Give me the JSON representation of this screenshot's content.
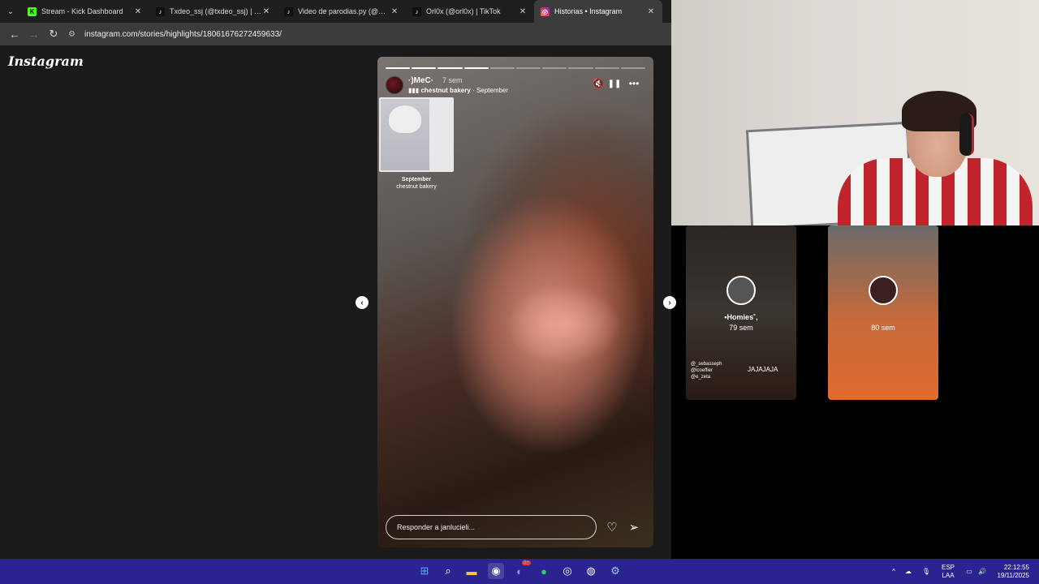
{
  "browser": {
    "tabs": [
      {
        "title": "Stream - Kick Dashboard",
        "favicon": "kick-icon",
        "color": "#53fc18"
      },
      {
        "title": "Txdeo_ssj (@txdeo_ssj) | TikTok",
        "favicon": "tiktok-icon",
        "color": "#111111"
      },
      {
        "title": "Video de parodias.py (@parodi",
        "favicon": "tiktok-icon",
        "color": "#111111"
      },
      {
        "title": "Orl0x (@orl0x) | TikTok",
        "favicon": "tiktok-icon",
        "color": "#111111"
      },
      {
        "title": "Historias • Instagram",
        "favicon": "instagram-icon",
        "color": "#e1306c"
      }
    ],
    "active_tab": 4,
    "url": "instagram.com/stories/highlights/18061676272459633/"
  },
  "instagram": {
    "logo": "Instagram",
    "story": {
      "username": "·)MeC·",
      "time": "7 sem",
      "music_title": "chestnut bakery",
      "music_album": "September",
      "card_title": "September",
      "card_artist": "chestnut bakery",
      "progress_segments": 10,
      "progress_done": 4,
      "reply_placeholder": "Responder a janlucieli..."
    },
    "previews": [
      {
        "name": "•Homies˚,",
        "time": "79 sem",
        "caption": "JAJAJAJA",
        "tags": [
          "@_sebasseph",
          "@lcoeffier",
          "@e_zeta"
        ]
      },
      {
        "name": "",
        "time": "80 sem"
      }
    ]
  },
  "taskbar": {
    "language": "ESP",
    "layout": "LAA",
    "time": "22:12:55",
    "date": "19/11/2025",
    "discord_badge": "9+"
  }
}
